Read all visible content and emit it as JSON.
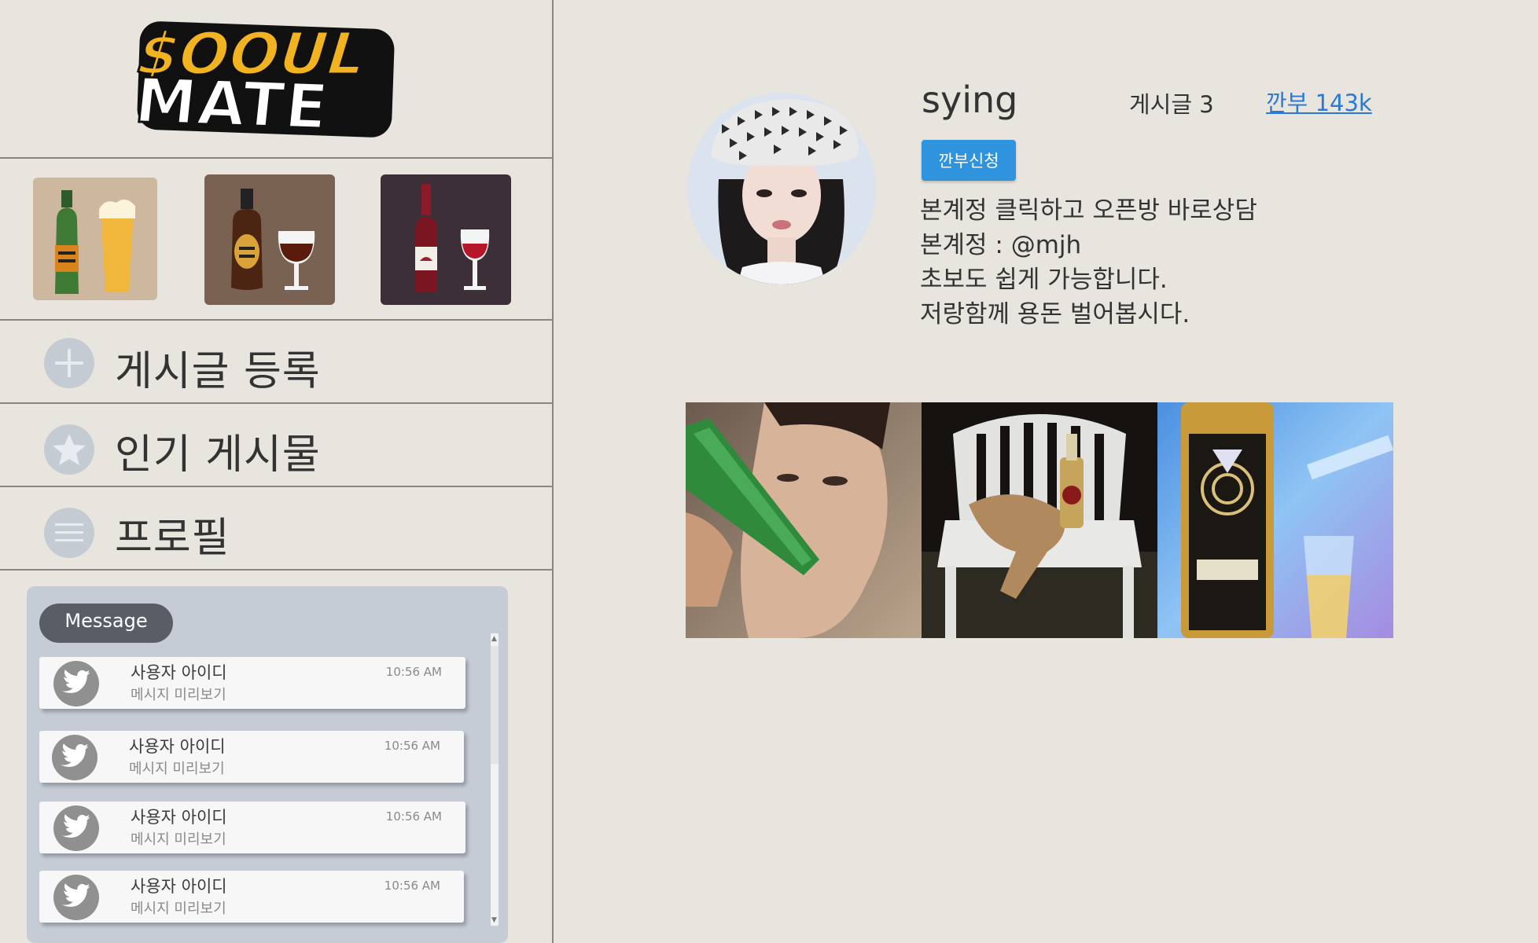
{
  "app": {
    "logo_text_line1": "$OOUL",
    "logo_text_line2": "MATE"
  },
  "categories": [
    {
      "name": "beer-category",
      "icon": "beer-bottle-and-glass-icon",
      "bg": "#cdb79e"
    },
    {
      "name": "whiskey-category",
      "icon": "whiskey-bottle-and-glass-icon",
      "bg": "#7a6252"
    },
    {
      "name": "wine-category",
      "icon": "wine-bottle-and-glass-icon",
      "bg": "#3d2f38"
    }
  ],
  "nav": {
    "new_post": "게시글 등록",
    "popular": "인기 게시물",
    "profile": "프로필"
  },
  "messages": {
    "title": "Message",
    "items": [
      {
        "user": "사용자 아이디",
        "preview": "메시지 미리보기",
        "time": "10:56 AM"
      },
      {
        "user": "사용자 아이디",
        "preview": "메시지 미리보기",
        "time": "10:56 AM"
      },
      {
        "user": "사용자 아이디",
        "preview": "메시지 미리보기",
        "time": "10:56 AM"
      },
      {
        "user": "사용자 아이디",
        "preview": "메시지 미리보기",
        "time": "10:56 AM"
      }
    ]
  },
  "profile": {
    "username": "sying",
    "post_count": "게시글 3",
    "followers": "깐부 143k",
    "follow_button": "깐부신청",
    "bio": [
      "본계정 클릭하고 오픈방 바로상담",
      "본계정 : @mjh",
      "초보도 쉽게 가능합니다.",
      "저랑함께 용돈 벌어봅시다."
    ]
  },
  "posts": [
    {
      "name": "post-man-drinking-soju"
    },
    {
      "name": "post-dog-on-chair"
    },
    {
      "name": "post-won-soju-bottle"
    }
  ],
  "colors": {
    "background": "#e8e4de",
    "accent": "#2f93de",
    "link": "#2a7ad3",
    "message_panel": "#c5ccd6"
  }
}
